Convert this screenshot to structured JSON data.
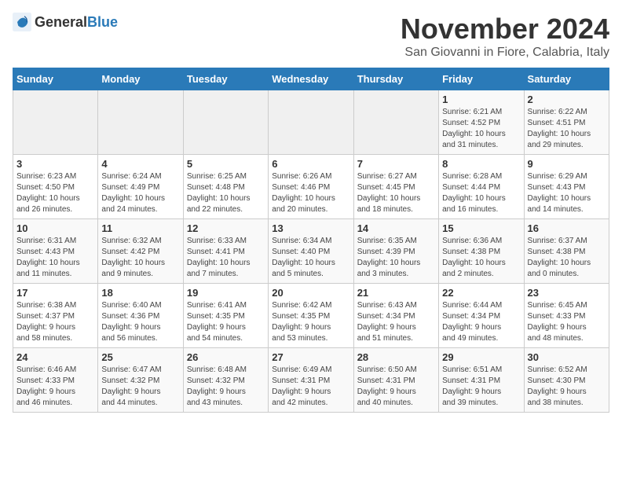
{
  "logo": {
    "general": "General",
    "blue": "Blue"
  },
  "title": "November 2024",
  "subtitle": "San Giovanni in Fiore, Calabria, Italy",
  "headers": [
    "Sunday",
    "Monday",
    "Tuesday",
    "Wednesday",
    "Thursday",
    "Friday",
    "Saturday"
  ],
  "weeks": [
    [
      {
        "day": "",
        "info": ""
      },
      {
        "day": "",
        "info": ""
      },
      {
        "day": "",
        "info": ""
      },
      {
        "day": "",
        "info": ""
      },
      {
        "day": "",
        "info": ""
      },
      {
        "day": "1",
        "info": "Sunrise: 6:21 AM\nSunset: 4:52 PM\nDaylight: 10 hours\nand 31 minutes."
      },
      {
        "day": "2",
        "info": "Sunrise: 6:22 AM\nSunset: 4:51 PM\nDaylight: 10 hours\nand 29 minutes."
      }
    ],
    [
      {
        "day": "3",
        "info": "Sunrise: 6:23 AM\nSunset: 4:50 PM\nDaylight: 10 hours\nand 26 minutes."
      },
      {
        "day": "4",
        "info": "Sunrise: 6:24 AM\nSunset: 4:49 PM\nDaylight: 10 hours\nand 24 minutes."
      },
      {
        "day": "5",
        "info": "Sunrise: 6:25 AM\nSunset: 4:48 PM\nDaylight: 10 hours\nand 22 minutes."
      },
      {
        "day": "6",
        "info": "Sunrise: 6:26 AM\nSunset: 4:46 PM\nDaylight: 10 hours\nand 20 minutes."
      },
      {
        "day": "7",
        "info": "Sunrise: 6:27 AM\nSunset: 4:45 PM\nDaylight: 10 hours\nand 18 minutes."
      },
      {
        "day": "8",
        "info": "Sunrise: 6:28 AM\nSunset: 4:44 PM\nDaylight: 10 hours\nand 16 minutes."
      },
      {
        "day": "9",
        "info": "Sunrise: 6:29 AM\nSunset: 4:43 PM\nDaylight: 10 hours\nand 14 minutes."
      }
    ],
    [
      {
        "day": "10",
        "info": "Sunrise: 6:31 AM\nSunset: 4:43 PM\nDaylight: 10 hours\nand 11 minutes."
      },
      {
        "day": "11",
        "info": "Sunrise: 6:32 AM\nSunset: 4:42 PM\nDaylight: 10 hours\nand 9 minutes."
      },
      {
        "day": "12",
        "info": "Sunrise: 6:33 AM\nSunset: 4:41 PM\nDaylight: 10 hours\nand 7 minutes."
      },
      {
        "day": "13",
        "info": "Sunrise: 6:34 AM\nSunset: 4:40 PM\nDaylight: 10 hours\nand 5 minutes."
      },
      {
        "day": "14",
        "info": "Sunrise: 6:35 AM\nSunset: 4:39 PM\nDaylight: 10 hours\nand 3 minutes."
      },
      {
        "day": "15",
        "info": "Sunrise: 6:36 AM\nSunset: 4:38 PM\nDaylight: 10 hours\nand 2 minutes."
      },
      {
        "day": "16",
        "info": "Sunrise: 6:37 AM\nSunset: 4:38 PM\nDaylight: 10 hours\nand 0 minutes."
      }
    ],
    [
      {
        "day": "17",
        "info": "Sunrise: 6:38 AM\nSunset: 4:37 PM\nDaylight: 9 hours\nand 58 minutes."
      },
      {
        "day": "18",
        "info": "Sunrise: 6:40 AM\nSunset: 4:36 PM\nDaylight: 9 hours\nand 56 minutes."
      },
      {
        "day": "19",
        "info": "Sunrise: 6:41 AM\nSunset: 4:35 PM\nDaylight: 9 hours\nand 54 minutes."
      },
      {
        "day": "20",
        "info": "Sunrise: 6:42 AM\nSunset: 4:35 PM\nDaylight: 9 hours\nand 53 minutes."
      },
      {
        "day": "21",
        "info": "Sunrise: 6:43 AM\nSunset: 4:34 PM\nDaylight: 9 hours\nand 51 minutes."
      },
      {
        "day": "22",
        "info": "Sunrise: 6:44 AM\nSunset: 4:34 PM\nDaylight: 9 hours\nand 49 minutes."
      },
      {
        "day": "23",
        "info": "Sunrise: 6:45 AM\nSunset: 4:33 PM\nDaylight: 9 hours\nand 48 minutes."
      }
    ],
    [
      {
        "day": "24",
        "info": "Sunrise: 6:46 AM\nSunset: 4:33 PM\nDaylight: 9 hours\nand 46 minutes."
      },
      {
        "day": "25",
        "info": "Sunrise: 6:47 AM\nSunset: 4:32 PM\nDaylight: 9 hours\nand 44 minutes."
      },
      {
        "day": "26",
        "info": "Sunrise: 6:48 AM\nSunset: 4:32 PM\nDaylight: 9 hours\nand 43 minutes."
      },
      {
        "day": "27",
        "info": "Sunrise: 6:49 AM\nSunset: 4:31 PM\nDaylight: 9 hours\nand 42 minutes."
      },
      {
        "day": "28",
        "info": "Sunrise: 6:50 AM\nSunset: 4:31 PM\nDaylight: 9 hours\nand 40 minutes."
      },
      {
        "day": "29",
        "info": "Sunrise: 6:51 AM\nSunset: 4:31 PM\nDaylight: 9 hours\nand 39 minutes."
      },
      {
        "day": "30",
        "info": "Sunrise: 6:52 AM\nSunset: 4:30 PM\nDaylight: 9 hours\nand 38 minutes."
      }
    ]
  ]
}
